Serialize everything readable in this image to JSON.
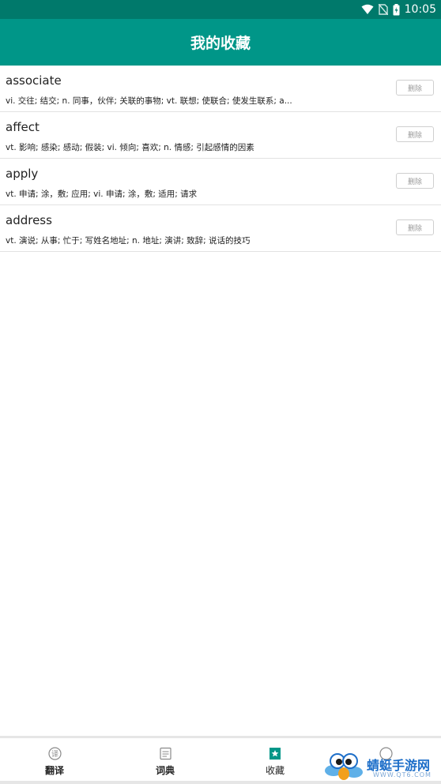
{
  "status_bar": {
    "time": "10:05"
  },
  "header": {
    "title": "我的收藏"
  },
  "favorites": [
    {
      "word": "associate",
      "meaning": "vi. 交往; 结交; n. 同事，伙伴; 关联的事物; vt. 联想; 使联合; 使发生联系; a...",
      "delete_label": "删除"
    },
    {
      "word": "affect",
      "meaning": "vt. 影响; 感染; 感动; 假装; vi. 倾向; 喜欢; n. 情感; 引起感情的因素",
      "delete_label": "删除"
    },
    {
      "word": "apply",
      "meaning": "vt. 申请; 涂，敷; 应用; vi. 申请; 涂，敷; 适用; 请求",
      "delete_label": "删除"
    },
    {
      "word": "address",
      "meaning": "vt. 演说; 从事; 忙于; 写姓名地址; n. 地址; 演讲; 致辞; 说话的技巧",
      "delete_label": "删除"
    }
  ],
  "bottom_nav": [
    {
      "label": "翻译",
      "icon": "translate-icon",
      "active": false
    },
    {
      "label": "词典",
      "icon": "dictionary-icon",
      "active": false
    },
    {
      "label": "收藏",
      "icon": "star-icon",
      "active": true
    },
    {
      "label": "",
      "icon": "profile-icon",
      "active": false
    }
  ],
  "watermark": {
    "name": "蜻蜓手游网",
    "url": "WWW.QT6.COM"
  },
  "colors": {
    "status_bar": "#00796b",
    "app_bar": "#009688",
    "active_icon": "#009688"
  }
}
